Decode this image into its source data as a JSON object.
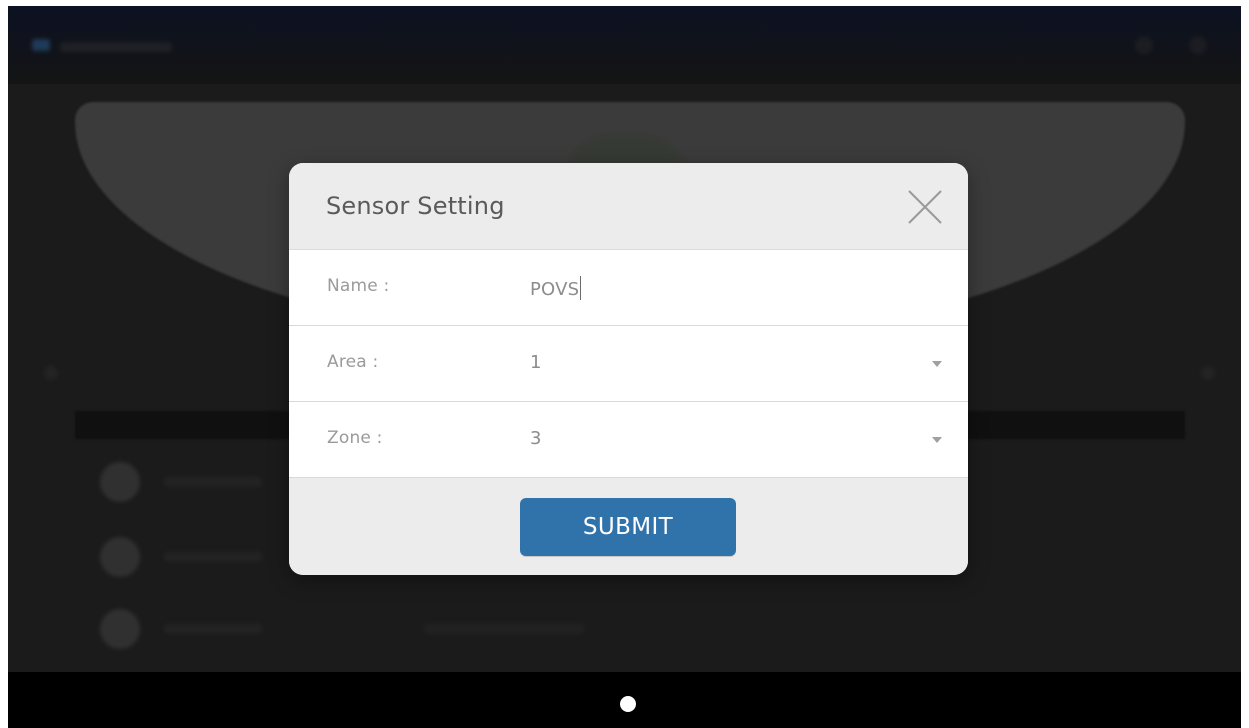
{
  "dialog": {
    "title": "Sensor Setting",
    "close_icon": "close-icon",
    "submit_label": "SUBMIT"
  },
  "form": {
    "name": {
      "label": "Name :",
      "value": "POVS"
    },
    "area": {
      "label": "Area :",
      "value": "1",
      "dropdown_icon": "chevron-down-icon"
    },
    "zone": {
      "label": "Zone :",
      "value": "3",
      "dropdown_icon": "chevron-down-icon"
    }
  },
  "colors": {
    "primary_button": "#2f73aa",
    "dialog_background": "#ececec",
    "text_muted": "#9a9a9a"
  }
}
